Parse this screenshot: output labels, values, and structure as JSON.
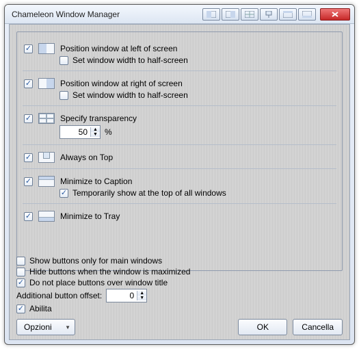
{
  "title": "Chameleon Window Manager",
  "options": [
    {
      "label": "Position window at left of screen",
      "sub": "Set window width to half-screen",
      "checked": true,
      "sub_checked": false
    },
    {
      "label": "Position window at right of screen",
      "sub": "Set window width to half-screen",
      "checked": true,
      "sub_checked": false
    },
    {
      "label": "Specify transparency",
      "checked": true,
      "value": "50",
      "unit": "%"
    },
    {
      "label": "Always on Top",
      "checked": true
    },
    {
      "label": "Minimize to Caption",
      "sub": "Temporarily show at the top of all windows",
      "checked": true,
      "sub_checked": true
    },
    {
      "label": "Minimize to Tray",
      "checked": true
    }
  ],
  "extra": {
    "only_main": {
      "label": "Show buttons only for main windows",
      "checked": false
    },
    "hide_max": {
      "label": "Hide buttons when the window is maximized",
      "checked": false
    },
    "not_title": {
      "label": "Do not place buttons over window title",
      "checked": true
    },
    "offset_label": "Additional button offset:",
    "offset_value": "0",
    "enable": {
      "label": "Abilita",
      "checked": true
    }
  },
  "buttons": {
    "options": "Opzioni",
    "ok": "OK",
    "cancel": "Cancella"
  }
}
